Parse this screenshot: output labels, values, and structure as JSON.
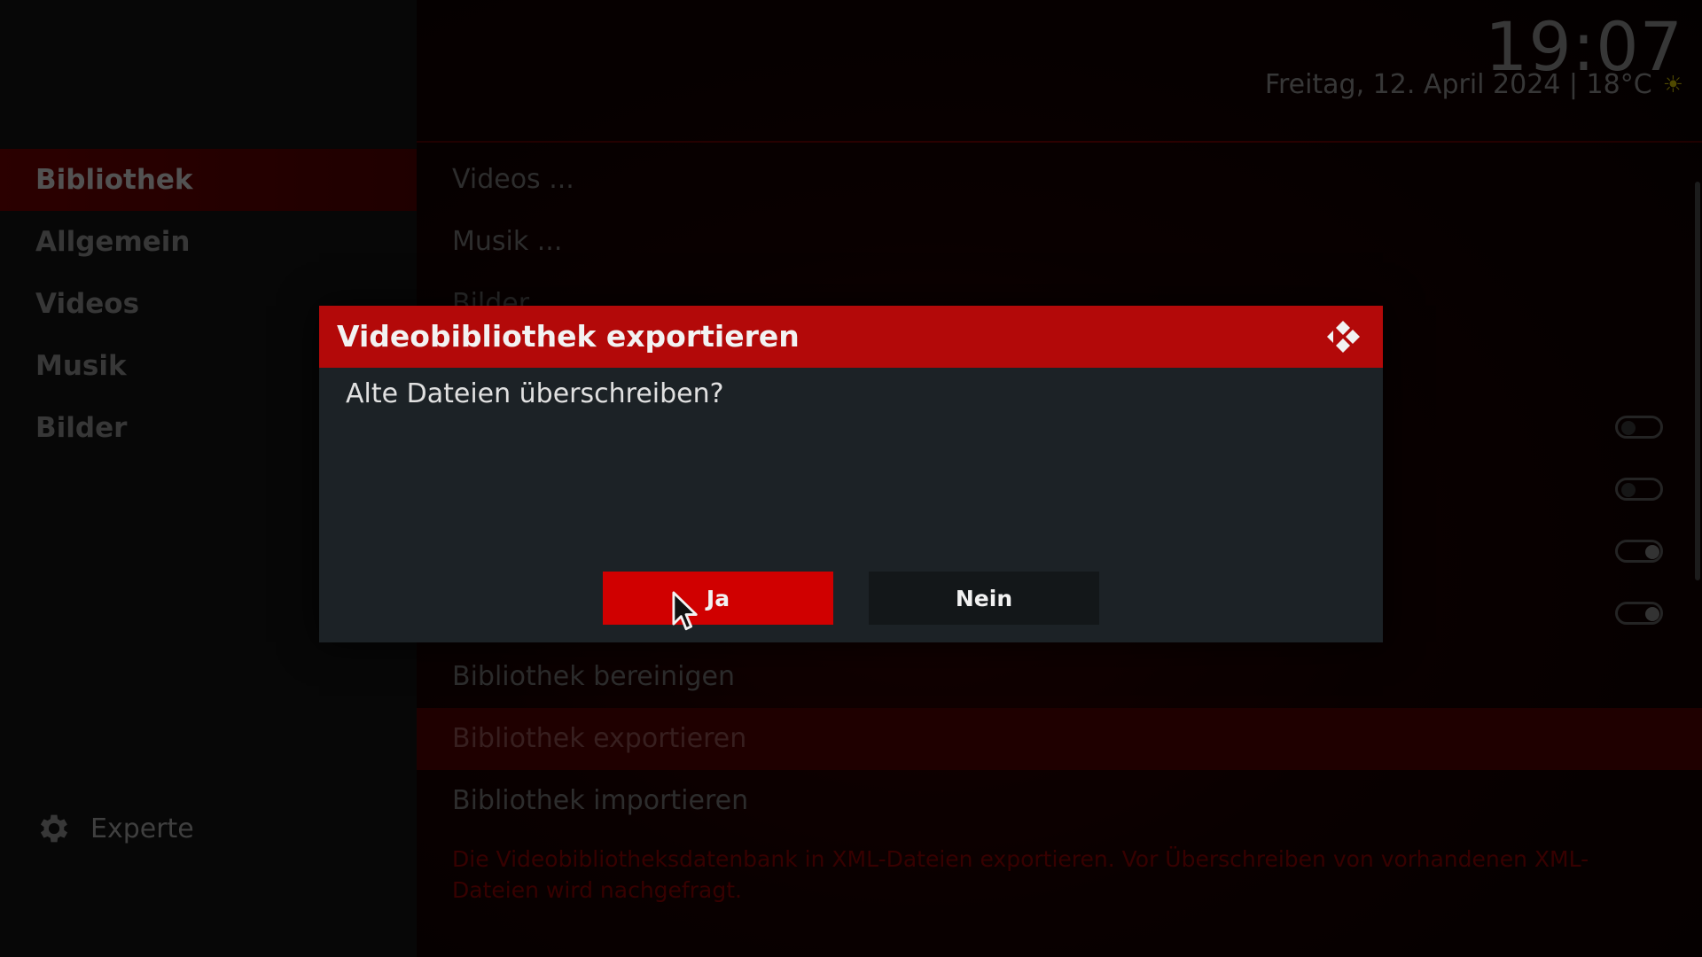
{
  "header": {
    "time": "19:07",
    "date_weather": "Freitag, 12. April 2024 | 18°C",
    "weather_icon": "sun-icon"
  },
  "sidebar": {
    "items": [
      {
        "label": "Bibliothek",
        "active": true
      },
      {
        "label": "Allgemein",
        "active": false
      },
      {
        "label": "Videos",
        "active": false
      },
      {
        "label": "Musik",
        "active": false
      },
      {
        "label": "Bilder",
        "active": false
      }
    ],
    "level_label": "Experte",
    "level_icon": "gear-icon"
  },
  "main": {
    "items": [
      {
        "label": "Videos ..."
      },
      {
        "label": "Musik ..."
      },
      {
        "label": "Bilder ..."
      },
      {
        "label": "Bibliothek bereinigen"
      },
      {
        "label": "Bibliothek exportieren",
        "selected": true
      },
      {
        "label": "Bibliothek importieren"
      }
    ],
    "toggles": [
      false,
      false,
      true,
      true
    ],
    "description": "Die Videobibliotheksdatenbank in XML-Dateien exportieren. Vor Überschreiben von vorhandenen XML-Dateien wird nachgefragt."
  },
  "dialog": {
    "title": "Videobibliothek exportieren",
    "message": "Alte Dateien überschreiben?",
    "yes_label": "Ja",
    "no_label": "Nein",
    "logo_icon": "kodi-logo-icon"
  },
  "colors": {
    "accent": "#b30909",
    "button_focus": "#d00000",
    "dialog_bg": "#1c2226"
  }
}
